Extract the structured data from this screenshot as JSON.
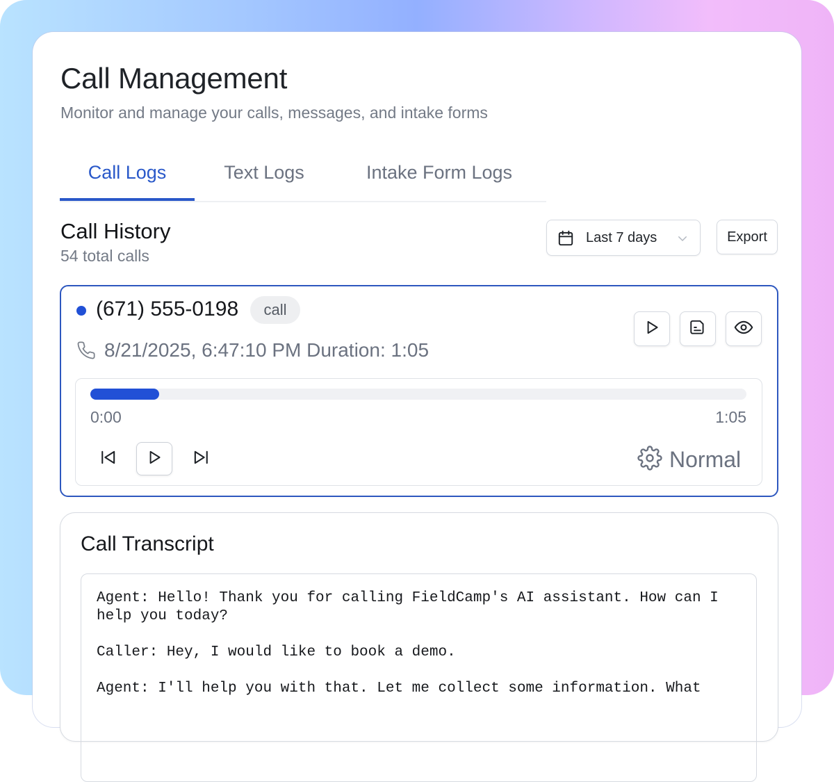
{
  "page": {
    "title": "Call Management",
    "subtitle": "Monitor and manage your calls, messages, and intake forms"
  },
  "tabs": [
    {
      "label": "Call Logs",
      "active": true
    },
    {
      "label": "Text Logs",
      "active": false
    },
    {
      "label": "Intake Form Logs",
      "active": false
    }
  ],
  "history": {
    "title": "Call History",
    "count_text": "54 total calls",
    "date_range": "Last 7 days",
    "export_label": "Export"
  },
  "call": {
    "phone": "(671) 555-0198",
    "type_badge": "call",
    "datetime": "8/21/2025, 6:47:10 PM",
    "duration_label": "Duration:",
    "duration": "1:05",
    "status_color": "#2150d6"
  },
  "player": {
    "current_time": "0:00",
    "total_time": "1:05",
    "progress_fraction": 0.105,
    "speed_label": "Normal"
  },
  "transcript": {
    "title": "Call Transcript",
    "text": "Agent: Hello! Thank you for calling FieldCamp's AI assistant. How can I help you today?\n\nCaller: Hey, I would like to book a demo.\n\nAgent: I'll help you with that. Let me collect some information. What"
  },
  "colors": {
    "accent": "#2958c9",
    "progress": "#2150d6",
    "muted_text": "#6b7280"
  }
}
